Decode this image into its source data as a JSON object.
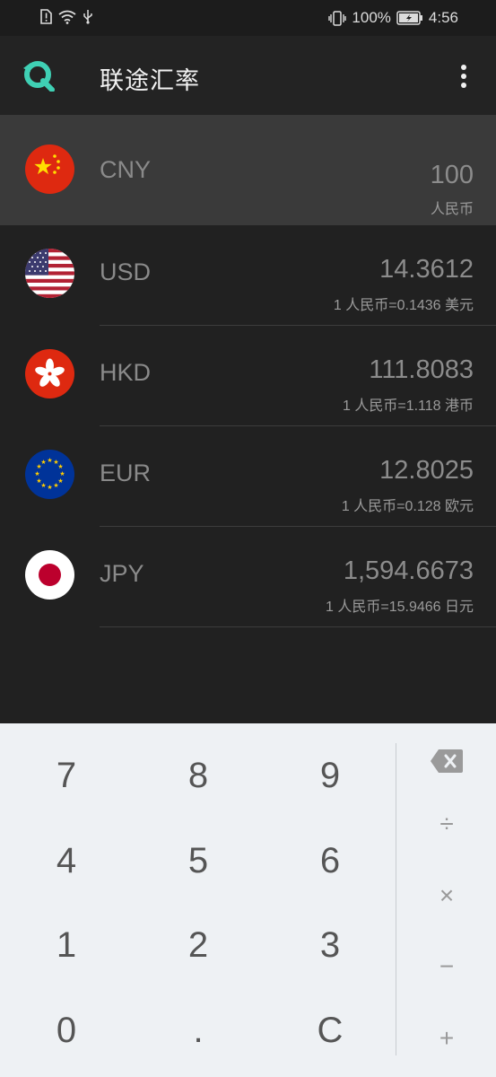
{
  "status_bar": {
    "battery": "100%",
    "time": "4:56"
  },
  "app": {
    "title": "联途汇率"
  },
  "base": {
    "code": "CNY",
    "amount": "100",
    "name": "人民币"
  },
  "currencies": [
    {
      "code": "USD",
      "amount": "14.3612",
      "rate": "1 人民币=0.1436 美元"
    },
    {
      "code": "HKD",
      "amount": "111.8083",
      "rate": "1 人民币=1.118 港币"
    },
    {
      "code": "EUR",
      "amount": "12.8025",
      "rate": "1 人民币=0.128 欧元"
    },
    {
      "code": "JPY",
      "amount": "1,594.6673",
      "rate": "1 人民币=15.9466 日元"
    }
  ],
  "keypad": {
    "k7": "7",
    "k8": "8",
    "k9": "9",
    "k4": "4",
    "k5": "5",
    "k6": "6",
    "k1": "1",
    "k2": "2",
    "k3": "3",
    "k0": "0",
    "dot": ".",
    "clear": "C",
    "divide": "÷",
    "multiply": "×",
    "minus": "−",
    "plus": "+"
  },
  "icons": {
    "logo": "refresh-q-logo-icon",
    "menu": "more-vert-icon",
    "backspace": "backspace-icon"
  },
  "colors": {
    "accent": "#3fd0b4",
    "background": "#212121",
    "selected_row": "#3a3a3a",
    "keypad_bg": "#eef1f4"
  }
}
